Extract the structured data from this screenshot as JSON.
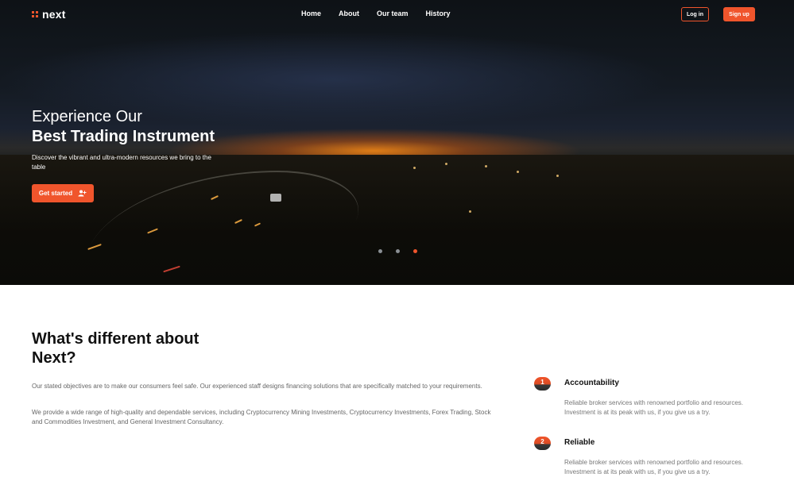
{
  "brand": {
    "name": "next",
    "accent": "#f0552c"
  },
  "nav": {
    "links": [
      "Home",
      "About",
      "Our team",
      "History"
    ],
    "login_label": "Log in",
    "signup_label": "Sign up"
  },
  "hero": {
    "title_line1": "Experience Our",
    "title_line2": "Best Trading Instrument",
    "subtitle": "Discover the vibrant and ultra-modern resources we bring to the table",
    "cta_label": "Get started",
    "cta_icon": "add-user-icon",
    "carousel": {
      "slides": 3,
      "active_index": 2
    }
  },
  "about": {
    "title": "What's different about Next?",
    "paragraph1": "Our stated objectives are to make our consumers feel safe. Our experienced staff designs financing solutions that are specifically matched to your requirements.",
    "paragraph2": "We provide a wide range of high-quality and dependable services, including Cryptocurrency Mining Investments, Cryptocurrency Investments, Forex Trading, Stock and Commodities Investment, and General Investment Consultancy."
  },
  "features": [
    {
      "number": "1",
      "title": "Accountability",
      "description": "Reliable broker services with renowned portfolio and resources. Investment is at its peak with us, if you give us a try."
    },
    {
      "number": "2",
      "title": "Reliable",
      "description": "Reliable broker services with renowned portfolio and resources. Investment is at its peak with us, if you give us a try."
    }
  ]
}
